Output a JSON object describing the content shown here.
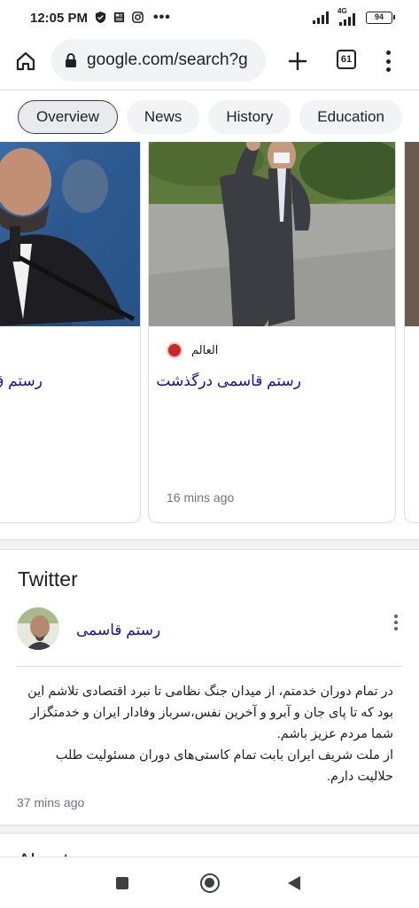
{
  "status_bar": {
    "time": "12:05 PM",
    "network": "4G",
    "battery": "94",
    "icons": [
      "shield-icon",
      "news-icon",
      "instagram-icon",
      "more-dots-icon",
      "signal-icon",
      "signal-4g-icon",
      "battery-icon"
    ]
  },
  "browser": {
    "url": "google.com/search?g",
    "tab_count": "61",
    "icons": [
      "home-icon",
      "lock-icon",
      "plus-icon",
      "tabs-icon",
      "menu-icon"
    ]
  },
  "chips": [
    {
      "label": "Overview",
      "active": true
    },
    {
      "label": "News",
      "active": false
    },
    {
      "label": "History",
      "active": false
    },
    {
      "label": "Education",
      "active": false
    }
  ],
  "news": {
    "cards": [
      {
        "title": "رستم ق",
        "source": "",
        "time": ""
      },
      {
        "title": "رستم قاسمی درگذشت",
        "source": "العالم",
        "time": "16 mins ago"
      }
    ]
  },
  "twitter": {
    "heading": "Twitter",
    "user_name": "رستم قاسمی",
    "tweet_text": "در تمام دوران خدمتم، از میدان جنگ نظامی تا نبرد اقتصادی تلاشم این بود که تا پای جان و آبرو و آخرین نفس،سرباز وفادار ایران و خدمتگزار شما مردم عزیز باشم.\nاز ملت شریف ایران بابت تمام کاستی‌های دوران مسئولیت طلب حلالیت دارم.",
    "time": "37 mins ago"
  },
  "next_section": {
    "label": "About"
  },
  "nav": {
    "icons": [
      "recents-square-icon",
      "home-circle-icon",
      "back-triangle-icon"
    ]
  },
  "colors": {
    "link": "#1a0dab",
    "chip_bg": "#f1f3f4",
    "muted_text": "#70757a"
  }
}
